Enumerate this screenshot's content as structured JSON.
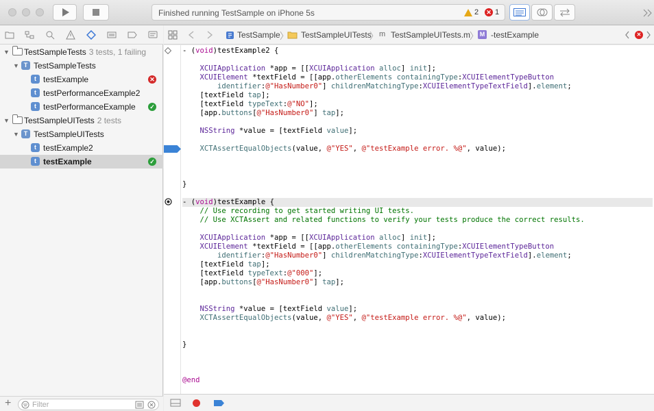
{
  "toolbar": {
    "status_text": "Finished running TestSample on iPhone 5s",
    "warning_count": "2",
    "error_count": "1"
  },
  "navigator": {
    "tree": [
      {
        "label": "TestSampleTests",
        "sub": "3 tests, 1 failing",
        "kind": "group"
      },
      {
        "label": "TestSampleTests",
        "kind": "class"
      },
      {
        "label": "testExample",
        "kind": "test",
        "status": "failed"
      },
      {
        "label": "testPerformanceExample2",
        "kind": "test",
        "status": "none"
      },
      {
        "label": "testPerformanceExample",
        "kind": "test",
        "status": "passed"
      },
      {
        "label": "TestSampleUITests",
        "sub": "2 tests",
        "kind": "group"
      },
      {
        "label": "TestSampleUITests",
        "kind": "class"
      },
      {
        "label": "testExample2",
        "kind": "test",
        "status": "none"
      },
      {
        "label": "testExample",
        "kind": "test",
        "status": "passed"
      }
    ],
    "filter_placeholder": "Filter"
  },
  "jumpbar": {
    "crumbs": [
      "TestSample",
      "TestSampleUITests",
      "TestSampleUITests.m",
      "-testExample"
    ]
  },
  "colors": {
    "breakpoint": "#3b83d6",
    "passed": "#2c9e3b",
    "failed": "#d42a2a"
  }
}
